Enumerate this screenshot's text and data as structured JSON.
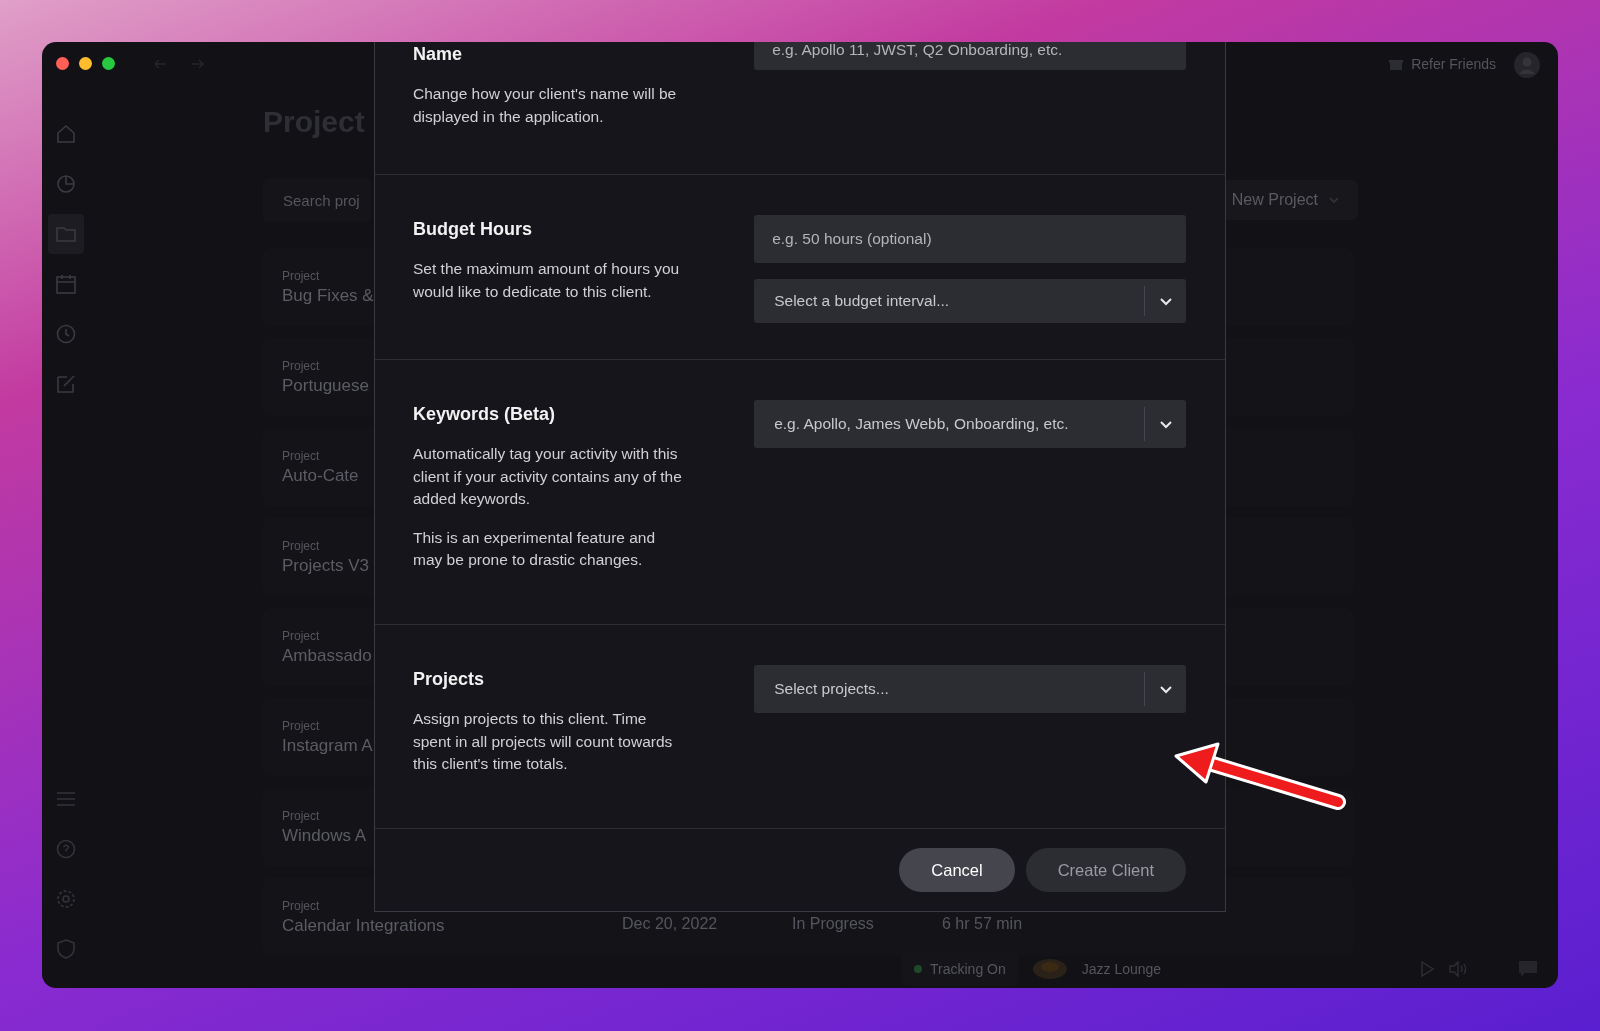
{
  "sidebar": {
    "items": [
      {
        "selected": false
      },
      {
        "selected": false
      },
      {
        "selected": true
      },
      {
        "selected": false
      },
      {
        "selected": false
      },
      {
        "selected": false
      }
    ]
  },
  "header": {
    "title": "Project",
    "search_placeholder": "Search proj",
    "new_project": "New Project",
    "refer": "Refer Friends"
  },
  "projects": [
    {
      "label": "Project",
      "name": "Bug Fixes &"
    },
    {
      "label": "Project",
      "name": "Portuguese"
    },
    {
      "label": "Project",
      "name": "Auto-Cate"
    },
    {
      "label": "Project",
      "name": "Projects V3"
    },
    {
      "label": "Project",
      "name": "Ambassado"
    },
    {
      "label": "Project",
      "name": "Instagram A"
    },
    {
      "label": "Project",
      "name": "Windows A"
    },
    {
      "label": "Project",
      "name": "Calendar Integrations",
      "date": "Dec 20, 2022",
      "status": "In Progress",
      "duration": "6 hr 57 min"
    }
  ],
  "player": {
    "tracking": "Tracking On",
    "track": "Jazz Lounge"
  },
  "dialog": {
    "sections": [
      {
        "title": "Name",
        "description": [
          "Change how your client's name will be displayed in the application."
        ],
        "fields": [
          {
            "kind": "input",
            "placeholder": "e.g. Apollo 11, JWST, Q2 Onboarding, etc."
          }
        ]
      },
      {
        "title": "Budget Hours",
        "description": [
          "Set the maximum amount of hours you would like to dedicate to this client."
        ],
        "fields": [
          {
            "kind": "input",
            "placeholder": "e.g. 50 hours (optional)"
          },
          {
            "kind": "select",
            "placeholder": "Select a budget interval..."
          }
        ]
      },
      {
        "title": "Keywords (Beta)",
        "description": [
          "Automatically tag your activity with this client if your activity contains any of the added keywords.",
          "This is an experimental feature and may be prone to drastic changes."
        ],
        "fields": [
          {
            "kind": "select",
            "placeholder": "e.g. Apollo, James Webb, Onboarding, etc."
          }
        ]
      },
      {
        "title": "Projects",
        "description": [
          "Assign projects to this client. Time spent in all projects will count towards this client's time totals."
        ],
        "fields": [
          {
            "kind": "select",
            "placeholder": "Select projects..."
          }
        ]
      }
    ],
    "buttons": [
      {
        "label": "Cancel",
        "disabled": false
      },
      {
        "label": "Create Client",
        "disabled": true
      }
    ]
  }
}
